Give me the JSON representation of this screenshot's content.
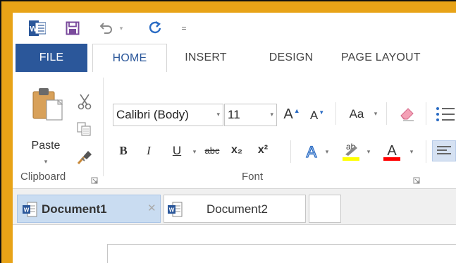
{
  "app": {
    "name": "Microsoft Word",
    "frame_color": "#e8a317",
    "accent": "#2b579a"
  },
  "qat": {
    "word_logo": "word-logo-icon",
    "word_logo_letter": "W",
    "save": "save-icon",
    "undo": "undo-icon",
    "redo": "redo-icon",
    "customize": "="
  },
  "tabs": {
    "file": "FILE",
    "home": "HOME",
    "insert": "INSERT",
    "design": "DESIGN",
    "page_layout": "PAGE LAYOUT",
    "active": "HOME"
  },
  "clipboard": {
    "paste_label": "Paste",
    "group_label": "Clipboard"
  },
  "font": {
    "font_name": "Calibri (Body)",
    "font_size": "11",
    "change_case_label": "Aa",
    "bold": "B",
    "italic": "I",
    "underline": "U",
    "strikethrough": "abc",
    "subscript": "x₂",
    "superscript": "x²",
    "text_effects": "A",
    "highlight": "ab",
    "font_color": "A",
    "grow_font": "A",
    "shrink_font": "A",
    "group_label": "Font",
    "highlight_color": "#ffff00",
    "font_color_value": "#ff0000"
  },
  "doc_tabs": [
    {
      "title": "Document1",
      "active": true
    },
    {
      "title": "Document2",
      "active": false
    }
  ]
}
